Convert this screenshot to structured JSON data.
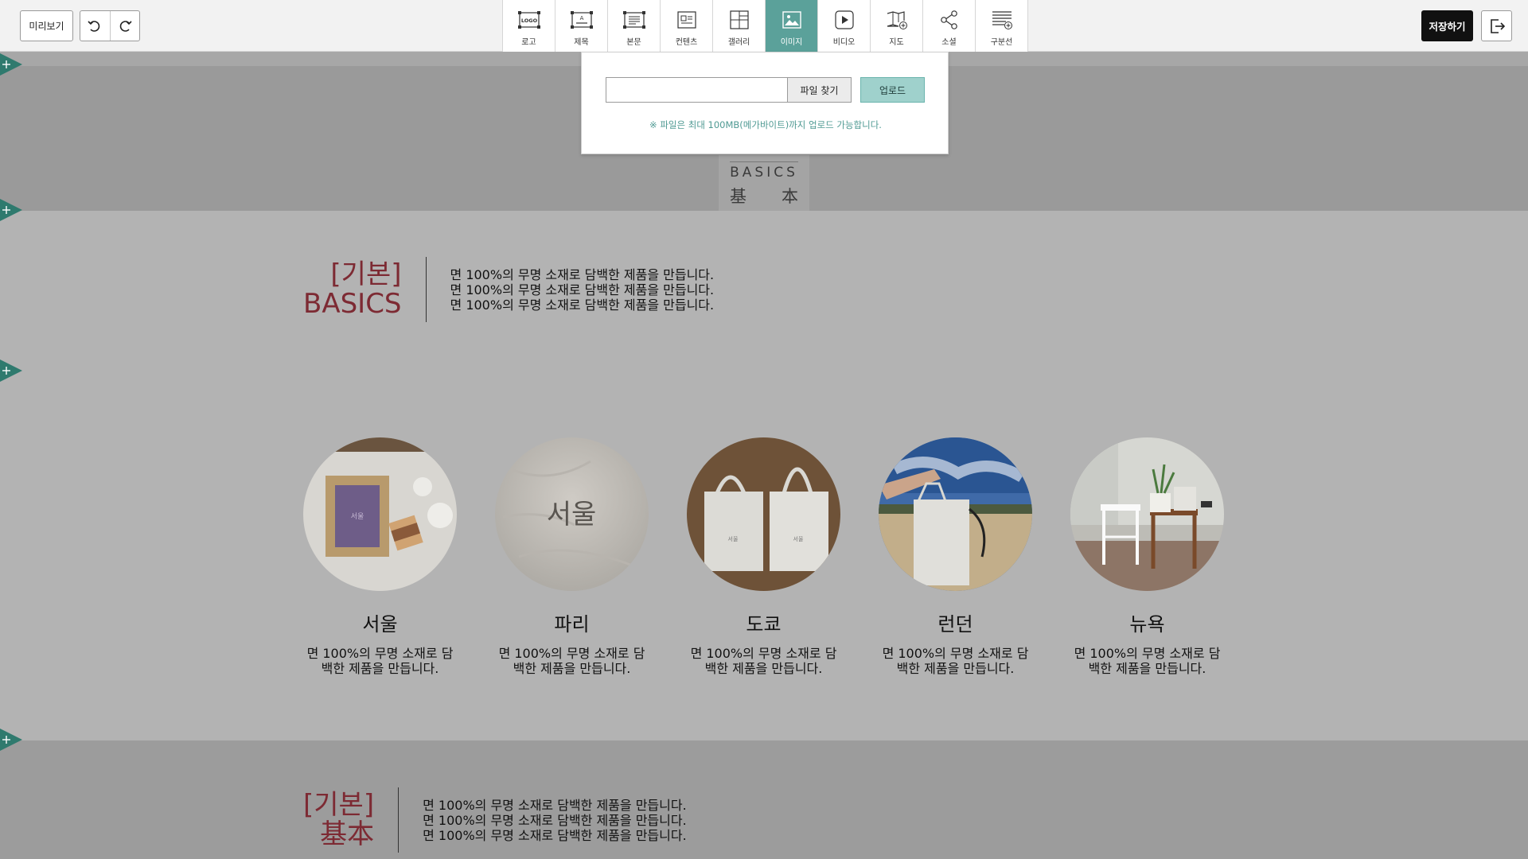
{
  "toolbar": {
    "preview_label": "미리보기",
    "save_label": "저장하기",
    "tools": [
      {
        "label": "로고",
        "icon": "logo-icon"
      },
      {
        "label": "제목",
        "icon": "title-icon"
      },
      {
        "label": "본문",
        "icon": "body-text-icon"
      },
      {
        "label": "컨텐츠",
        "icon": "contents-icon"
      },
      {
        "label": "갤러리",
        "icon": "gallery-icon"
      },
      {
        "label": "이미지",
        "icon": "image-icon",
        "active": true
      },
      {
        "label": "비디오",
        "icon": "video-icon"
      },
      {
        "label": "지도",
        "icon": "map-icon"
      },
      {
        "label": "소셜",
        "icon": "share-icon"
      },
      {
        "label": "구분선",
        "icon": "divider-icon"
      }
    ],
    "logo_icon_text": "LOGO",
    "title_icon_text": "A"
  },
  "upload": {
    "file_value": "",
    "find_label": "파일 찾기",
    "upload_label": "업로드",
    "note": "※ 파일은 최대 100MB(메가바이트)까지 업로드 가능합니다."
  },
  "hero": {
    "logo_en": "BASICS",
    "logo_cn_1": "基",
    "logo_cn_2": "本"
  },
  "intro1": {
    "title_1": "[기본]",
    "title_2": "BASICS",
    "lines": [
      "면 100%의 무명 소재로 담백한 제품을 만듭니다.",
      "면 100%의 무명 소재로 담백한 제품을 만듭니다.",
      "면 100%의 무명 소재로 담백한 제품을 만듭니다."
    ]
  },
  "cities": [
    {
      "name": "서울",
      "desc_1": "면 100%의 무명 소재로 담",
      "desc_2": "백한 제품을 만듭니다."
    },
    {
      "name": "파리",
      "desc_1": "면 100%의 무명 소재로 담",
      "desc_2": "백한 제품을 만듭니다.",
      "photo_text": "서울"
    },
    {
      "name": "도쿄",
      "desc_1": "면 100%의 무명 소재로 담",
      "desc_2": "백한 제품을 만듭니다."
    },
    {
      "name": "런던",
      "desc_1": "면 100%의 무명 소재로 담",
      "desc_2": "백한 제품을 만듭니다."
    },
    {
      "name": "뉴욕",
      "desc_1": "면 100%의 무명 소재로 담",
      "desc_2": "백한 제품을 만듭니다."
    }
  ],
  "intro2": {
    "title_1": "[기본]",
    "title_2": "基本",
    "lines": [
      "면 100%의 무명 소재로 담백한 제품을 만듭니다.",
      "면 100%의 무명 소재로 담백한 제품을 만듭니다.",
      "면 100%의 무명 소재로 담백한 제품을 만듭니다."
    ]
  },
  "colors": {
    "accent": "#5ba19a",
    "title_red": "#7d2a33",
    "marker": "#2f7a6e"
  }
}
